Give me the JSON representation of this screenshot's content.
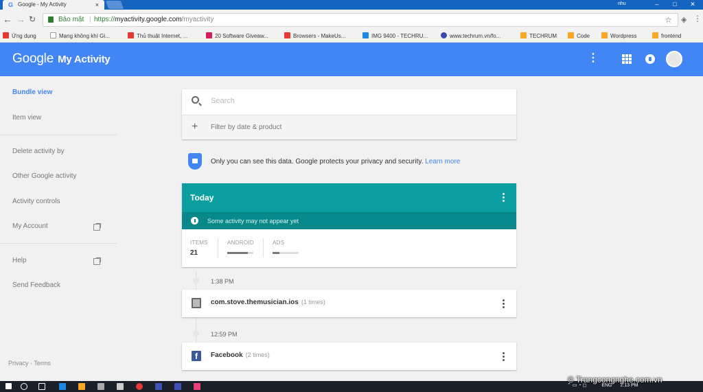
{
  "browser": {
    "tab_title": "Google - My Activity",
    "tab_close": "×",
    "window_user": "nhu",
    "win_min": "–",
    "win_max": "□",
    "win_close": "✕",
    "security_label": "Bảo mật",
    "url_scheme": "https://",
    "url_host": "myactivity.google.com",
    "url_path": "/myactivity",
    "bookmarks": [
      {
        "label": "Ứng dụng",
        "color": "#e53935"
      },
      {
        "label": "Mạng không khí Gi...",
        "color": "#ffffff"
      },
      {
        "label": "Thủ thuật Internet, ...",
        "color": "#e53935"
      },
      {
        "label": "20 Software Giveaw...",
        "color": "#d81b60"
      },
      {
        "label": "Browsers - MakeUs...",
        "color": "#e53935"
      },
      {
        "label": "IMG 9400 - TECHRU...",
        "color": "#1e88e5"
      },
      {
        "label": "www.techrum.vn/fo...",
        "color": "#3949ab"
      },
      {
        "label": "TECHRUM",
        "color": "#f9a825"
      },
      {
        "label": "Code",
        "color": "#f9a825"
      },
      {
        "label": "Wordpress",
        "color": "#f9a825"
      },
      {
        "label": "frontend",
        "color": "#f9a825"
      }
    ]
  },
  "header": {
    "brand": "Google",
    "product": "My Activity"
  },
  "sidebar": {
    "items": [
      {
        "label": "Bundle view"
      },
      {
        "label": "Item view"
      },
      {
        "label": "Delete activity by"
      },
      {
        "label": "Other Google activity"
      },
      {
        "label": "Activity controls"
      },
      {
        "label": "My Account"
      },
      {
        "label": "Help"
      },
      {
        "label": "Send Feedback"
      }
    ],
    "footer": {
      "privacy": "Privacy",
      "dot": "·",
      "terms": "Terms"
    }
  },
  "search": {
    "placeholder": "Search",
    "filter_label": "Filter by date & product"
  },
  "privacy_notice": {
    "text": "Only you can see this data. Google protects your privacy and security.",
    "link": "Learn more"
  },
  "today": {
    "title": "Today",
    "note": "Some activity may not appear yet",
    "stats": {
      "items_label": "ITEMS",
      "items_value": "21",
      "android_label": "ANDROID",
      "android_fraction": 0.8,
      "ads_label": "ADS",
      "ads_fraction": 0.25
    }
  },
  "activities": [
    {
      "time": "1:38 PM",
      "title": "com.stove.themusician.ios",
      "count": "(1 times)",
      "icon": "document-icon"
    },
    {
      "time": "12:59 PM",
      "title": "Facebook",
      "count": "(2 times)",
      "icon": "facebook-icon"
    }
  ],
  "taskbar": {
    "lang": "ENG",
    "time": "2:13 PM",
    "watermark": "© Trangcongnghe.com.vn"
  }
}
